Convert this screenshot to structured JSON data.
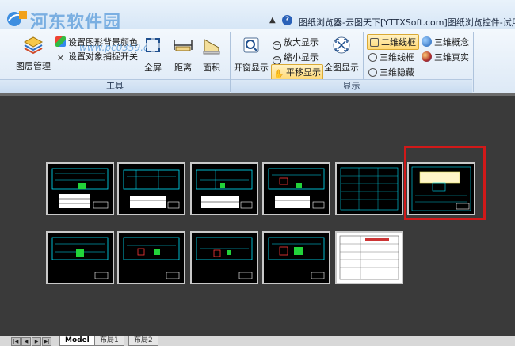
{
  "titlebar": {
    "watermark": "河东软件园",
    "window_title": "图纸浏览器-云图天下[YTTXSoft.com]图纸浏览控件-试用版",
    "help": "?"
  },
  "ribbon": {
    "tools": {
      "layer_manager": "图层管理",
      "set_background": "设置图形背景颜色",
      "set_snap": "设置对象捕捉开关",
      "site_watermark": "www.pc0359.cn",
      "fullscreen": "全屏",
      "distance": "距离",
      "area": "面积",
      "caption": "工具"
    },
    "display": {
      "window_display": "开窗显示",
      "zoom_in": "放大显示",
      "zoom_out": "缩小显示",
      "pan": "平移显示",
      "full_view": "全图显示",
      "wireframe_2d": "二维线框",
      "wireframe_3d": "三维线框",
      "hidden_3d": "三维隐藏",
      "concept_3d": "三维概念",
      "realistic_3d": "三维真实",
      "caption": "显示"
    }
  },
  "tabs": {
    "nav": [
      "|◀",
      "◀",
      "▶",
      "▶|"
    ],
    "items": [
      "Model",
      "布局1",
      "布局2"
    ]
  },
  "colors": {
    "highlight": "#d11919",
    "canvas": "#3a3a3a",
    "drawing_cyan": "#00e5ff"
  }
}
